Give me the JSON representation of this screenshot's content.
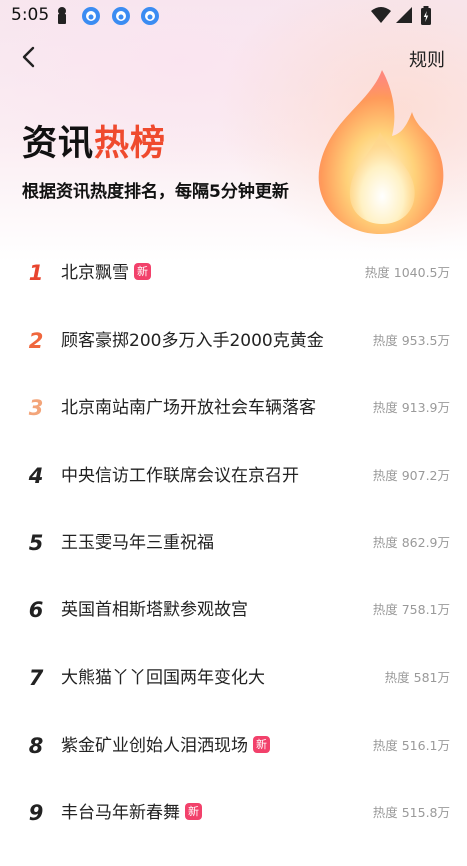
{
  "status": {
    "time": "5:05"
  },
  "nav": {
    "rules_label": "规则"
  },
  "hero": {
    "title_part1": "资讯",
    "title_part2": "热榜",
    "subtitle": "根据资讯热度排名，每隔5分钟更新"
  },
  "colors": {
    "rank1": "#e8452f",
    "rank2": "#f0673d",
    "rank3": "#f3a57a",
    "rank_default": "#222222",
    "new_badge": "#f2416b"
  },
  "items": [
    {
      "rank": "1",
      "title": "北京飘雪",
      "is_new": true,
      "new_label": "新",
      "heat": "热度 1040.5万"
    },
    {
      "rank": "2",
      "title": "顾客豪掷200多万入手2000克黄金",
      "is_new": false,
      "new_label": "",
      "heat": "热度 953.5万"
    },
    {
      "rank": "3",
      "title": "北京南站南广场开放社会车辆落客",
      "is_new": false,
      "new_label": "",
      "heat": "热度 913.9万"
    },
    {
      "rank": "4",
      "title": "中央信访工作联席会议在京召开",
      "is_new": false,
      "new_label": "",
      "heat": "热度 907.2万"
    },
    {
      "rank": "5",
      "title": "王玉雯马年三重祝福",
      "is_new": false,
      "new_label": "",
      "heat": "热度 862.9万"
    },
    {
      "rank": "6",
      "title": "英国首相斯塔默参观故宫",
      "is_new": false,
      "new_label": "",
      "heat": "热度 758.1万"
    },
    {
      "rank": "7",
      "title": "大熊猫丫丫回国两年变化大",
      "is_new": false,
      "new_label": "",
      "heat": "热度 581万"
    },
    {
      "rank": "8",
      "title": "紫金矿业创始人泪洒现场",
      "is_new": true,
      "new_label": "新",
      "heat": "热度 516.1万"
    },
    {
      "rank": "9",
      "title": "丰台马年新春舞",
      "is_new": true,
      "new_label": "新",
      "heat": "热度 515.8万"
    }
  ]
}
